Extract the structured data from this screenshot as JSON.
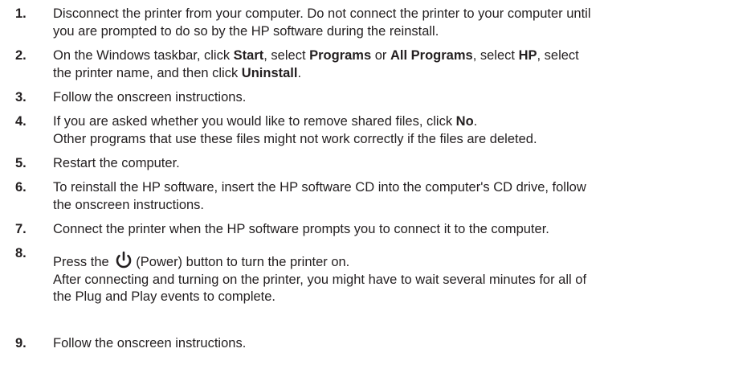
{
  "steps": [
    {
      "number": "1.",
      "lines": [
        "Disconnect the printer from your computer. Do not connect the printer to your computer until",
        "you are prompted to do so by the HP software during the reinstall."
      ]
    },
    {
      "number": "2.",
      "parts": {
        "t1": "On the Windows taskbar, click ",
        "b1": "Start",
        "t2": ", select ",
        "b2": "Programs",
        "t3": " or ",
        "b3": "All Programs",
        "t4": ", select ",
        "b4": "HP",
        "t5": ", select",
        "t6": "the printer name, and then click ",
        "b5": "Uninstall",
        "t7": "."
      }
    },
    {
      "number": "3.",
      "text": "Follow the onscreen instructions."
    },
    {
      "number": "4.",
      "parts": {
        "t1": "If you are asked whether you would like to remove shared files, click ",
        "b1": "No",
        "t2": ".",
        "t3": "Other programs that use these files might not work correctly if the files are deleted."
      }
    },
    {
      "number": "5.",
      "text": "Restart the computer."
    },
    {
      "number": "6.",
      "lines": [
        "To reinstall the HP software, insert the HP software CD into the computer's CD drive, follow",
        "the onscreen instructions."
      ]
    },
    {
      "number": "7.",
      "text": "Connect the printer when the HP software prompts you to connect it to the computer."
    },
    {
      "number": "8.",
      "parts": {
        "t1": "Press the ",
        "icon": "power-icon",
        "t2": "(Power) button to turn the printer on.",
        "t3": "After connecting and turning on the printer, you might have to wait several minutes for all of",
        "t4": "the Plug and Play events to complete."
      }
    },
    {
      "number": "9.",
      "text": "Follow the onscreen instructions."
    }
  ]
}
